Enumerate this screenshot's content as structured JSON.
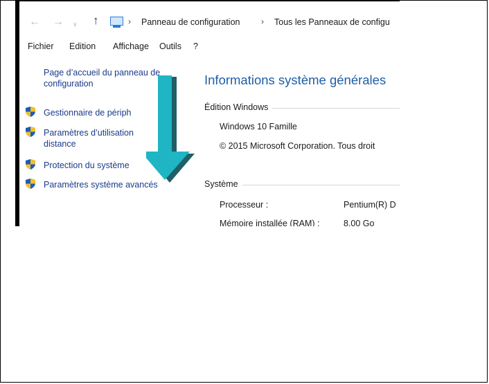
{
  "nav": {
    "back_icon": "arrow-left-icon",
    "forward_icon": "arrow-right-icon",
    "recent_icon": "chevron-down-icon",
    "up_icon": "arrow-up-icon",
    "location_icon": "control-panel-icon",
    "separator": "›",
    "breadcrumb": [
      "Panneau de configuration",
      "Tous les Panneaux de configu"
    ]
  },
  "menu": [
    "Fichier",
    "Edition",
    "Affichage",
    "Outils",
    "?"
  ],
  "sidebar": {
    "home_link": [
      "Page d’accueil du panneau de",
      "configuration"
    ],
    "items": [
      {
        "icon": "shield-icon",
        "lines": [
          "Gestionnaire de périph"
        ]
      },
      {
        "icon": "shield-icon",
        "lines": [
          "Paramètres d’utilisation",
          "distance"
        ]
      },
      {
        "icon": "shield-icon",
        "lines": [
          "Protection du système"
        ]
      },
      {
        "icon": "shield-icon",
        "lines": [
          "Paramètres système avancés"
        ]
      }
    ]
  },
  "overlay": {
    "icon": "arrow-down-icon",
    "color": "#1fb5c4",
    "shadow": "#1f5f66"
  },
  "main": {
    "title": "Informations système générales",
    "edition": {
      "label": "Édition Windows",
      "name": "Windows 10 Famille",
      "copyright": "© 2015 Microsoft Corporation. Tous droit"
    },
    "system": {
      "label": "Système",
      "rows": [
        {
          "key": "Processeur :",
          "value": "Pentium(R) D"
        },
        {
          "key": "Mémoire installée (RAM) :",
          "value": "8,00 Go"
        }
      ]
    }
  },
  "colors": {
    "link": "#1a3a8a",
    "title": "#1e5fa6",
    "shield_blue": "#1e5bb8",
    "shield_yellow": "#f2c029"
  }
}
